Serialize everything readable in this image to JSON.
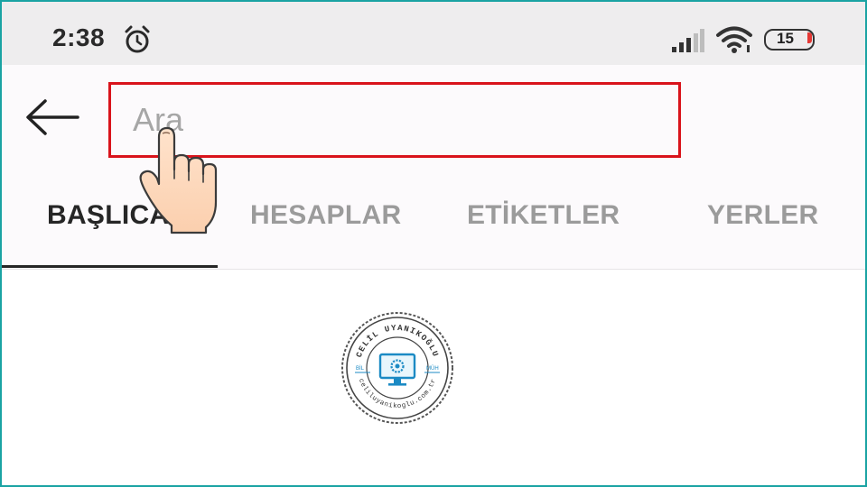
{
  "status_bar": {
    "time": "2:38",
    "alarm_icon": "alarm-clock-icon",
    "signal_icon": "cell-signal-icon",
    "wifi_icon": "wifi-icon",
    "battery_level": "15",
    "battery_low_color": "#e53935"
  },
  "header": {
    "back_icon": "arrow-left-icon",
    "search": {
      "placeholder": "Ara",
      "value": "",
      "highlight_color": "#d9131b"
    },
    "tabs": [
      {
        "label": "BAŞLICA",
        "active": true
      },
      {
        "label": "HESAPLAR",
        "active": false
      },
      {
        "label": "ETİKETLER",
        "active": false
      },
      {
        "label": "YERLER",
        "active": false
      }
    ]
  },
  "overlay": {
    "pointer_icon": "pointing-hand-icon"
  },
  "watermark": {
    "top_text": "CELİL UYANIKOĞLU",
    "bottom_text": "celiluyanikoglu.com.tr",
    "left_text": "BİL",
    "right_text": "MÜH",
    "icon": "monitor-gear-icon"
  },
  "colors": {
    "accent_frame": "#1aa3a3",
    "tab_active": "#262626",
    "tab_inactive": "#9b9b9b",
    "status_bar_bg": "#eeedee"
  }
}
